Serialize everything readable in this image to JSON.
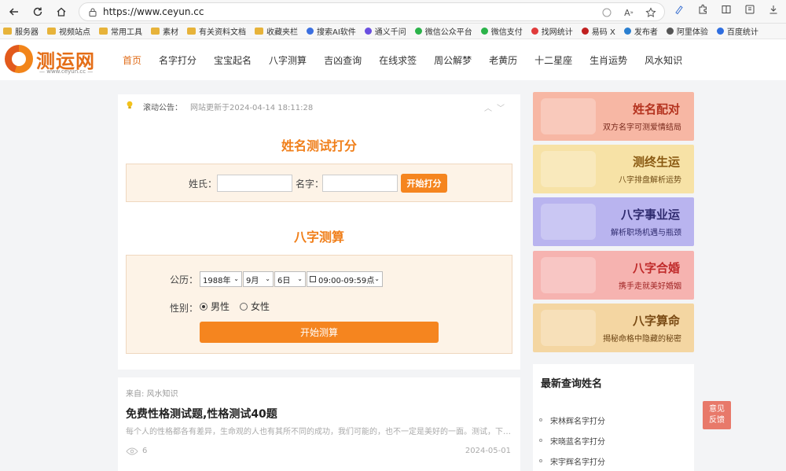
{
  "browser": {
    "url": "https://www.ceyun.cc"
  },
  "bookmarks": [
    {
      "label": "服务器",
      "kind": "folder"
    },
    {
      "label": "视频站点",
      "kind": "folder"
    },
    {
      "label": "常用工具",
      "kind": "folder"
    },
    {
      "label": "素材",
      "kind": "folder"
    },
    {
      "label": "有关资料文档",
      "kind": "folder"
    },
    {
      "label": "收藏夹栏",
      "kind": "folder"
    },
    {
      "label": "搜索AI软件",
      "kind": "site",
      "color": "#3b6fe0"
    },
    {
      "label": "通义千问",
      "kind": "site",
      "color": "#6a4fe0"
    },
    {
      "label": "微信公众平台",
      "kind": "site",
      "color": "#2bb34a"
    },
    {
      "label": "微信支付",
      "kind": "site",
      "color": "#2bb34a"
    },
    {
      "label": "找网统计",
      "kind": "site",
      "color": "#e03b3b"
    },
    {
      "label": "易码 X",
      "kind": "site",
      "color": "#c02020"
    },
    {
      "label": "发布者",
      "kind": "site",
      "color": "#2a7fd0"
    },
    {
      "label": "阿里体验",
      "kind": "site",
      "color": "#555555"
    },
    {
      "label": "百度统计",
      "kind": "site",
      "color": "#2f6ee0"
    }
  ],
  "site": {
    "logo_name": "测运网",
    "logo_url": "— www.ceyun.cc —",
    "nav": [
      {
        "label": "首页",
        "active": true
      },
      {
        "label": "名字打分",
        "active": false
      },
      {
        "label": "宝宝起名",
        "active": false
      },
      {
        "label": "八字测算",
        "active": false
      },
      {
        "label": "吉凶查询",
        "active": false
      },
      {
        "label": "在线求签",
        "active": false
      },
      {
        "label": "周公解梦",
        "active": false
      },
      {
        "label": "老黄历",
        "active": false
      },
      {
        "label": "十二星座",
        "active": false
      },
      {
        "label": "生肖运势",
        "active": false
      },
      {
        "label": "风水知识",
        "active": false
      }
    ]
  },
  "notice": {
    "label": "滚动公告：",
    "text": "网站更新于2024-04-14 18:11:28"
  },
  "name_test": {
    "title": "姓名测试打分",
    "surname_label": "姓氏：",
    "name_label": "名字：",
    "submit": "开始打分"
  },
  "bazi": {
    "title": "八字测算",
    "calendar_label": "公历：",
    "year": "1988年",
    "month": "9月",
    "day": "6日",
    "hour": "09:00-09:59点",
    "gender_label": "性别：",
    "male": "男性",
    "female": "女性",
    "selected_gender": "male",
    "submit": "开始测算"
  },
  "article": {
    "tag": "来自: 风水知识",
    "title": "免费性格测试题,性格测试40题",
    "desc": "每个人的性格都各有差异，生命观的人也有其所不同的成功，我们可能的，也不一定是美好的一面。测试，下就知...",
    "views": "6",
    "date": "2024-05-01"
  },
  "banners": [
    {
      "title": "姓名配对",
      "sub": "双方名字可测爱情结局",
      "bg": "#f7b7a4",
      "title_color": "#b4331f",
      "sub_color": "#7a2a1c"
    },
    {
      "title": "测终生运",
      "sub": "八字排盘解析运势",
      "bg": "#f7e2a6",
      "title_color": "#8a5a12",
      "sub_color": "#6f4b14"
    },
    {
      "title": "八字事业运",
      "sub": "解析职场机遇与瓶颈",
      "bg": "#b9b4ef",
      "title_color": "#2e2a6e",
      "sub_color": "#2e2a6e"
    },
    {
      "title": "八字合婚",
      "sub": "携手走就美好婚姻",
      "bg": "#f6b3b0",
      "title_color": "#c02b2b",
      "sub_color": "#a12626"
    },
    {
      "title": "八字算命",
      "sub": "揭秘命格中隐藏的秘密",
      "bg": "#f4d6a2",
      "title_color": "#7a4b14",
      "sub_color": "#6a4212"
    }
  ],
  "hot": {
    "title": "最新查询姓名",
    "items": [
      "宋林辉名字打分",
      "宋晓蓝名字打分",
      "宋宇辉名字打分"
    ]
  },
  "feedback": {
    "line1": "意见",
    "line2": "反馈"
  }
}
